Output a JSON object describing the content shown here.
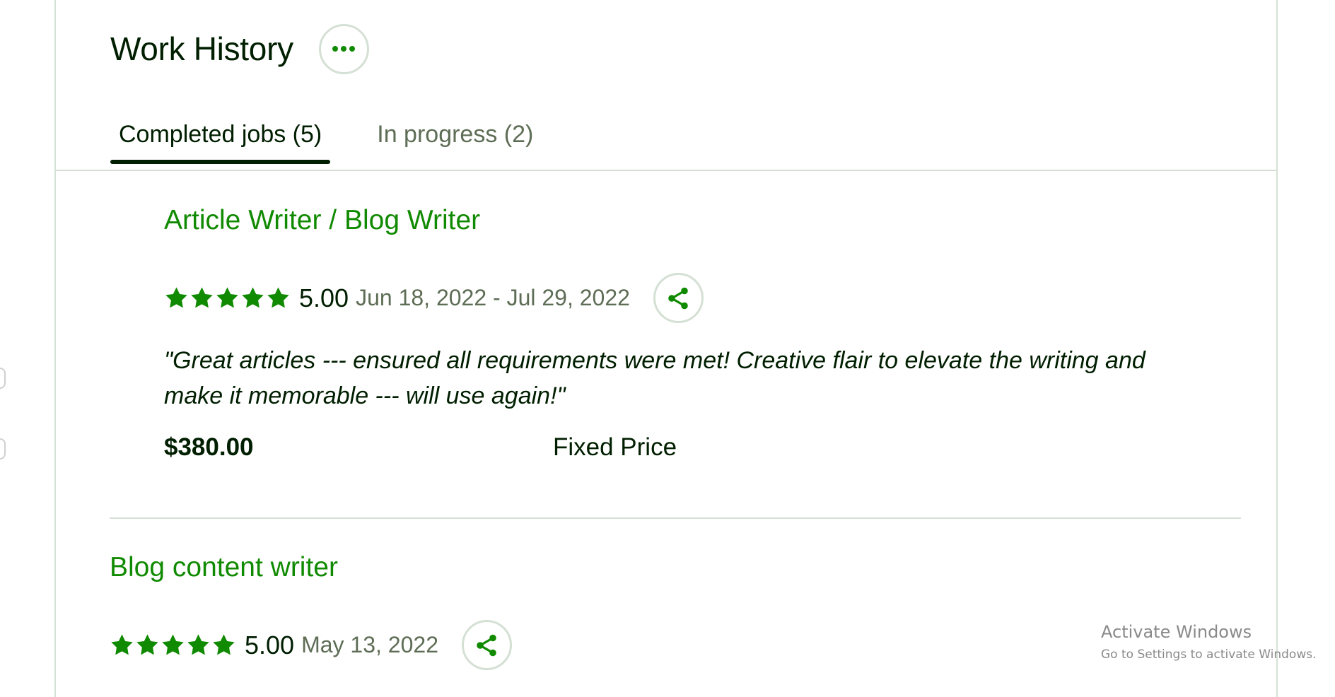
{
  "section": {
    "title": "Work History"
  },
  "tabs": [
    {
      "label": "Completed jobs (5)",
      "active": true
    },
    {
      "label": "In progress (2)",
      "active": false
    }
  ],
  "jobs": [
    {
      "title": "Article Writer / Blog Writer",
      "stars": 5,
      "rating": "5.00",
      "dates": "Jun 18, 2022 - Jul 29, 2022",
      "feedback_line1": "\"Great articles --- ensured all requirements were met! Creative flair to elevate the writing and",
      "feedback_line2": "make it memorable --- will use again!\"",
      "amount": "$380.00",
      "price_type": "Fixed Price"
    },
    {
      "title": "Blog content writer",
      "stars": 5,
      "rating": "5.00",
      "dates": "May 13, 2022"
    }
  ],
  "watermark": {
    "line1": "Activate Windows",
    "line2": "Go to Settings to activate Windows."
  },
  "colors": {
    "accent": "#108a00",
    "text": "#001e00",
    "muted": "#5e6d55",
    "border": "#d5e0d5"
  },
  "icons": [
    "more-horizontal-icon",
    "star-icon",
    "share-icon"
  ]
}
